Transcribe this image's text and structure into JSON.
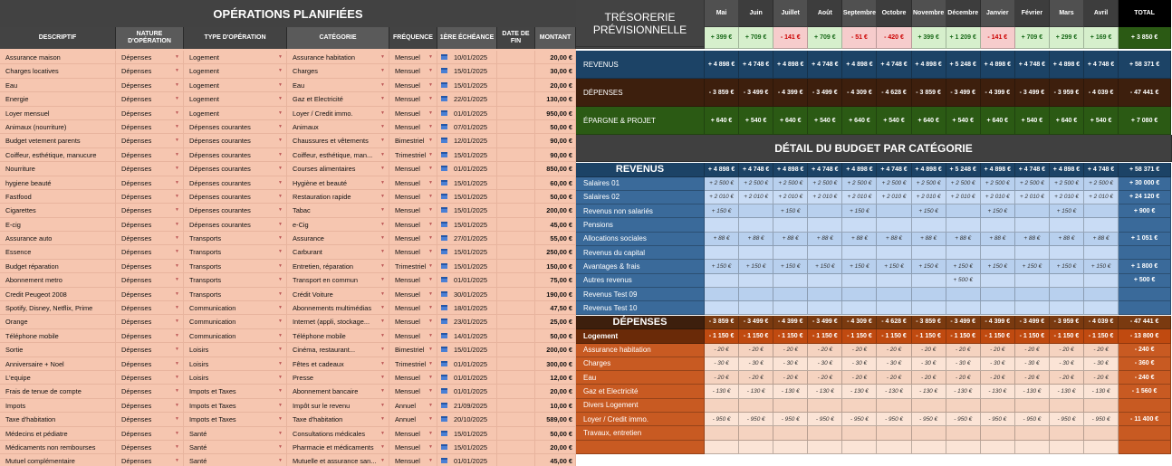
{
  "operations": {
    "title": "OPÉRATIONS PLANIFIÉES",
    "columns": [
      "DESCRIPTIF",
      "NATURE D'OPÉRATION",
      "TYPE D'OPÉRATION",
      "CATÉGORIE",
      "FRÉQUENCE",
      "1ÈRE ÉCHÉANCE",
      "DATE DE FIN",
      "MONTANT"
    ],
    "rows": [
      [
        "Assurance maison",
        "Dépenses",
        "Logement",
        "Assurance habitation",
        "Mensuel",
        "10/01/2025",
        "",
        "20,00 €"
      ],
      [
        "Charges locatives",
        "Dépenses",
        "Logement",
        "Charges",
        "Mensuel",
        "15/01/2025",
        "",
        "30,00 €"
      ],
      [
        "Eau",
        "Dépenses",
        "Logement",
        "Eau",
        "Mensuel",
        "15/01/2025",
        "",
        "20,00 €"
      ],
      [
        "Energie",
        "Dépenses",
        "Logement",
        "Gaz et Electricité",
        "Mensuel",
        "22/01/2025",
        "",
        "130,00 €"
      ],
      [
        "Loyer mensuel",
        "Dépenses",
        "Logement",
        "Loyer / Credit immo.",
        "Mensuel",
        "01/01/2025",
        "",
        "950,00 €"
      ],
      [
        "Animaux (nourriture)",
        "Dépenses",
        "Dépenses courantes",
        "Animaux",
        "Mensuel",
        "07/01/2025",
        "",
        "50,00 €"
      ],
      [
        "Budget vetement parents",
        "Dépenses",
        "Dépenses courantes",
        "Chaussures et vêtements",
        "Bimestriel",
        "12/01/2025",
        "",
        "90,00 €"
      ],
      [
        "Coiffeur, esthétique, manucure",
        "Dépenses",
        "Dépenses courantes",
        "Coiffeur, esthétique, man...",
        "Trimestriel",
        "15/01/2025",
        "",
        "90,00 €"
      ],
      [
        "Nourriture",
        "Dépenses",
        "Dépenses courantes",
        "Courses alimentaires",
        "Mensuel",
        "01/01/2025",
        "",
        "850,00 €"
      ],
      [
        "hygiene beauté",
        "Dépenses",
        "Dépenses courantes",
        "Hygiène et beauté",
        "Mensuel",
        "15/01/2025",
        "",
        "60,00 €"
      ],
      [
        "Fastfood",
        "Dépenses",
        "Dépenses courantes",
        "Restauration rapide",
        "Mensuel",
        "15/01/2025",
        "",
        "50,00 €"
      ],
      [
        "Cigarettes",
        "Dépenses",
        "Dépenses courantes",
        "Tabac",
        "Mensuel",
        "15/01/2025",
        "",
        "200,00 €"
      ],
      [
        "E-cig",
        "Dépenses",
        "Dépenses courantes",
        "e-Cig",
        "Mensuel",
        "15/01/2025",
        "",
        "45,00 €"
      ],
      [
        "Assurance auto",
        "Dépenses",
        "Transports",
        "Assurance",
        "Mensuel",
        "27/01/2025",
        "",
        "55,00 €"
      ],
      [
        "Essence",
        "Dépenses",
        "Transports",
        "Carburant",
        "Mensuel",
        "15/01/2025",
        "",
        "250,00 €"
      ],
      [
        "Budget réparation",
        "Dépenses",
        "Transports",
        "Entretien, réparation",
        "Trimestriel",
        "15/01/2025",
        "",
        "150,00 €"
      ],
      [
        "Abonnement metro",
        "Dépenses",
        "Transports",
        "Transport en commun",
        "Mensuel",
        "01/01/2025",
        "",
        "75,00 €"
      ],
      [
        "Credit Peugeot 2008",
        "Dépenses",
        "Transports",
        "Crédit Voiture",
        "Mensuel",
        "30/01/2025",
        "",
        "190,00 €"
      ],
      [
        "Spotify, Disney, Netflix, Prime",
        "Dépenses",
        "Communication",
        "Abonnements multimédias",
        "Mensuel",
        "18/01/2025",
        "",
        "47,50 €"
      ],
      [
        "Orange",
        "Dépenses",
        "Communication",
        "Internet (appli, stockage...",
        "Mensuel",
        "23/01/2025",
        "",
        "25,00 €"
      ],
      [
        "Téléphone mobile",
        "Dépenses",
        "Communication",
        "Téléphone mobile",
        "Mensuel",
        "14/01/2025",
        "",
        "50,00 €"
      ],
      [
        "Sortie",
        "Dépenses",
        "Loisirs",
        "Cinéma, restaurant...",
        "Bimestriel",
        "15/01/2025",
        "",
        "200,00 €"
      ],
      [
        "Anniversaire + Noel",
        "Dépenses",
        "Loisirs",
        "Fêtes et cadeaux",
        "Trimestriel",
        "01/01/2025",
        "",
        "300,00 €"
      ],
      [
        "L'equipe",
        "Dépenses",
        "Loisirs",
        "Presse",
        "Mensuel",
        "01/01/2025",
        "",
        "12,00 €"
      ],
      [
        "Frais de tenue de compte",
        "Dépenses",
        "Impots et Taxes",
        "Abonnement bancaire",
        "Mensuel",
        "01/01/2025",
        "",
        "20,00 €"
      ],
      [
        "Impots",
        "Dépenses",
        "Impots et Taxes",
        "Impôt sur le revenu",
        "Annuel",
        "21/09/2025",
        "",
        "10,00 €"
      ],
      [
        "Taxe d'habitation",
        "Dépenses",
        "Impots et Taxes",
        "Taxe d'habitation",
        "Annuel",
        "20/10/2025",
        "",
        "589,00 €"
      ],
      [
        "Médecins et pédiatre",
        "Dépenses",
        "Santé",
        "Consultations médicales",
        "Mensuel",
        "15/01/2025",
        "",
        "50,00 €"
      ],
      [
        "Médicaments non rembourses",
        "Dépenses",
        "Santé",
        "Pharmacie et médicaments",
        "Mensuel",
        "15/01/2025",
        "",
        "20,00 €"
      ],
      [
        "Mutuel complémentaire",
        "Dépenses",
        "Santé",
        "Mutuelle et assurance san...",
        "Mensuel",
        "01/01/2025",
        "",
        "45,00 €"
      ]
    ]
  },
  "tresorerie": {
    "title": "TRÉSORERIE PRÉVISIONNELLE",
    "months": [
      "Mai",
      "Juin",
      "Juillet",
      "Août",
      "Septembre",
      "Octobre",
      "Novembre",
      "Décembre",
      "Janvier",
      "Février",
      "Mars",
      "Avril"
    ],
    "total_label": "TOTAL",
    "balance": [
      "+ 399 €",
      "+ 709 €",
      "- 141 €",
      "+ 709 €",
      "- 51 €",
      "- 420 €",
      "+ 399 €",
      "+ 1 209 €",
      "- 141 €",
      "+ 709 €",
      "+ 299 €",
      "+ 169 €"
    ],
    "balance_total": "+ 3 850 €",
    "summary": [
      {
        "label": "REVENUS",
        "values": [
          "+ 4 898 €",
          "+ 4 748 €",
          "+ 4 898 €",
          "+ 4 748 €",
          "+ 4 898 €",
          "+ 4 748 €",
          "+ 4 898 €",
          "+ 5 248 €",
          "+ 4 898 €",
          "+ 4 748 €",
          "+ 4 898 €",
          "+ 4 748 €"
        ],
        "total": "+ 58 371 €"
      },
      {
        "label": "DÉPENSES",
        "values": [
          "- 3 859 €",
          "- 3 499 €",
          "- 4 399 €",
          "- 3 499 €",
          "- 4 309 €",
          "- 4 628 €",
          "- 3 859 €",
          "- 3 499 €",
          "- 4 399 €",
          "- 3 499 €",
          "- 3 959 €",
          "- 4 039 €"
        ],
        "total": "- 47 441 €"
      },
      {
        "label": "ÉPARGNE & PROJET",
        "values": [
          "+ 640 €",
          "+ 540 €",
          "+ 640 €",
          "+ 540 €",
          "+ 640 €",
          "+ 540 €",
          "+ 640 €",
          "+ 540 €",
          "+ 640 €",
          "+ 540 €",
          "+ 640 €",
          "+ 540 €"
        ],
        "total": "+ 7 080 €"
      }
    ],
    "detail_title": "DÉTAIL DU BUDGET PAR CATÉGORIE",
    "revenus_head": {
      "label": "REVENUS",
      "values": [
        "+ 4 898 €",
        "+ 4 748 €",
        "+ 4 898 €",
        "+ 4 748 €",
        "+ 4 898 €",
        "+ 4 748 €",
        "+ 4 898 €",
        "+ 5 248 €",
        "+ 4 898 €",
        "+ 4 748 €",
        "+ 4 898 €",
        "+ 4 748 €"
      ],
      "total": "+ 58 371 €"
    },
    "revenus_rows": [
      {
        "label": "Salaires 01",
        "values": [
          "+ 2 500 €",
          "+ 2 500 €",
          "+ 2 500 €",
          "+ 2 500 €",
          "+ 2 500 €",
          "+ 2 500 €",
          "+ 2 500 €",
          "+ 2 500 €",
          "+ 2 500 €",
          "+ 2 500 €",
          "+ 2 500 €",
          "+ 2 500 €"
        ],
        "total": "+ 30 000 €"
      },
      {
        "label": "Salaires 02",
        "values": [
          "+ 2 010 €",
          "+ 2 010 €",
          "+ 2 010 €",
          "+ 2 010 €",
          "+ 2 010 €",
          "+ 2 010 €",
          "+ 2 010 €",
          "+ 2 010 €",
          "+ 2 010 €",
          "+ 2 010 €",
          "+ 2 010 €",
          "+ 2 010 €"
        ],
        "total": "+ 24 120 €"
      },
      {
        "label": "Revenus non salariés",
        "values": [
          "+ 150 €",
          "",
          "+ 150 €",
          "",
          "+ 150 €",
          "",
          "+ 150 €",
          "",
          "+ 150 €",
          "",
          "+ 150 €",
          ""
        ],
        "total": "+ 900 €"
      },
      {
        "label": "Pensions",
        "values": [
          "",
          "",
          "",
          "",
          "",
          "",
          "",
          "",
          "",
          "",
          "",
          ""
        ],
        "total": ""
      },
      {
        "label": "Allocations sociales",
        "values": [
          "+ 88 €",
          "+ 88 €",
          "+ 88 €",
          "+ 88 €",
          "+ 88 €",
          "+ 88 €",
          "+ 88 €",
          "+ 88 €",
          "+ 88 €",
          "+ 88 €",
          "+ 88 €",
          "+ 88 €"
        ],
        "total": "+ 1 051 €"
      },
      {
        "label": "Revenus du capital",
        "values": [
          "",
          "",
          "",
          "",
          "",
          "",
          "",
          "",
          "",
          "",
          "",
          ""
        ],
        "total": ""
      },
      {
        "label": "Avantages & frais",
        "values": [
          "+ 150 €",
          "+ 150 €",
          "+ 150 €",
          "+ 150 €",
          "+ 150 €",
          "+ 150 €",
          "+ 150 €",
          "+ 150 €",
          "+ 150 €",
          "+ 150 €",
          "+ 150 €",
          "+ 150 €"
        ],
        "total": "+ 1 800 €"
      },
      {
        "label": "Autres revenus",
        "values": [
          "",
          "",
          "",
          "",
          "",
          "",
          "",
          "+ 500 €",
          "",
          "",
          "",
          ""
        ],
        "total": "+ 500 €"
      },
      {
        "label": "Revenus Test 09",
        "values": [
          "",
          "",
          "",
          "",
          "",
          "",
          "",
          "",
          "",
          "",
          "",
          ""
        ],
        "total": ""
      },
      {
        "label": "Revenus Test 10",
        "values": [
          "",
          "",
          "",
          "",
          "",
          "",
          "",
          "",
          "",
          "",
          "",
          ""
        ],
        "total": ""
      }
    ],
    "depenses_head": {
      "label": "DÉPENSES",
      "values": [
        "- 3 859 €",
        "- 3 499 €",
        "- 4 399 €",
        "- 3 499 €",
        "- 4 309 €",
        "- 4 628 €",
        "- 3 859 €",
        "- 3 499 €",
        "- 4 399 €",
        "- 3 499 €",
        "- 3 959 €",
        "- 4 039 €"
      ],
      "total": "- 47 441 €"
    },
    "logement_head": {
      "label": "Logement",
      "values": [
        "- 1 150 €",
        "- 1 150 €",
        "- 1 150 €",
        "- 1 150 €",
        "- 1 150 €",
        "- 1 150 €",
        "- 1 150 €",
        "- 1 150 €",
        "- 1 150 €",
        "- 1 150 €",
        "- 1 150 €",
        "- 1 150 €"
      ],
      "total": "- 13 800 €"
    },
    "logement_rows": [
      {
        "label": "Assurance habitation",
        "values": [
          "- 20 €",
          "- 20 €",
          "- 20 €",
          "- 20 €",
          "- 20 €",
          "- 20 €",
          "- 20 €",
          "- 20 €",
          "- 20 €",
          "- 20 €",
          "- 20 €",
          "- 20 €"
        ],
        "total": "- 240 €"
      },
      {
        "label": "Charges",
        "values": [
          "- 30 €",
          "- 30 €",
          "- 30 €",
          "- 30 €",
          "- 30 €",
          "- 30 €",
          "- 30 €",
          "- 30 €",
          "- 30 €",
          "- 30 €",
          "- 30 €",
          "- 30 €"
        ],
        "total": "- 360 €"
      },
      {
        "label": "Eau",
        "values": [
          "- 20 €",
          "- 20 €",
          "- 20 €",
          "- 20 €",
          "- 20 €",
          "- 20 €",
          "- 20 €",
          "- 20 €",
          "- 20 €",
          "- 20 €",
          "- 20 €",
          "- 20 €"
        ],
        "total": "- 240 €"
      },
      {
        "label": "Gaz et Electricité",
        "values": [
          "- 130 €",
          "- 130 €",
          "- 130 €",
          "- 130 €",
          "- 130 €",
          "- 130 €",
          "- 130 €",
          "- 130 €",
          "- 130 €",
          "- 130 €",
          "- 130 €",
          "- 130 €"
        ],
        "total": "- 1 560 €"
      },
      {
        "label": "Divers Logement",
        "values": [
          "",
          "",
          "",
          "",
          "",
          "",
          "",
          "",
          "",
          "",
          "",
          ""
        ],
        "total": ""
      },
      {
        "label": "Loyer / Credit immo.",
        "values": [
          "- 950 €",
          "- 950 €",
          "- 950 €",
          "- 950 €",
          "- 950 €",
          "- 950 €",
          "- 950 €",
          "- 950 €",
          "- 950 €",
          "- 950 €",
          "- 950 €",
          "- 950 €"
        ],
        "total": "- 11 400 €"
      },
      {
        "label": "Travaux, entretien",
        "values": [
          "",
          "",
          "",
          "",
          "",
          "",
          "",
          "",
          "",
          "",
          "",
          ""
        ],
        "total": ""
      },
      {
        "label": "",
        "values": [
          "",
          "",
          "",
          "",
          "",
          "",
          "",
          "",
          "",
          "",
          "",
          ""
        ],
        "total": ""
      }
    ],
    "colors": {
      "revenus": "#1c4366",
      "depenses": "#3d1f0d",
      "epargne": "#2b5a14",
      "positive_bg": "#d6efcc",
      "negative_bg": "#f6cccc"
    }
  }
}
